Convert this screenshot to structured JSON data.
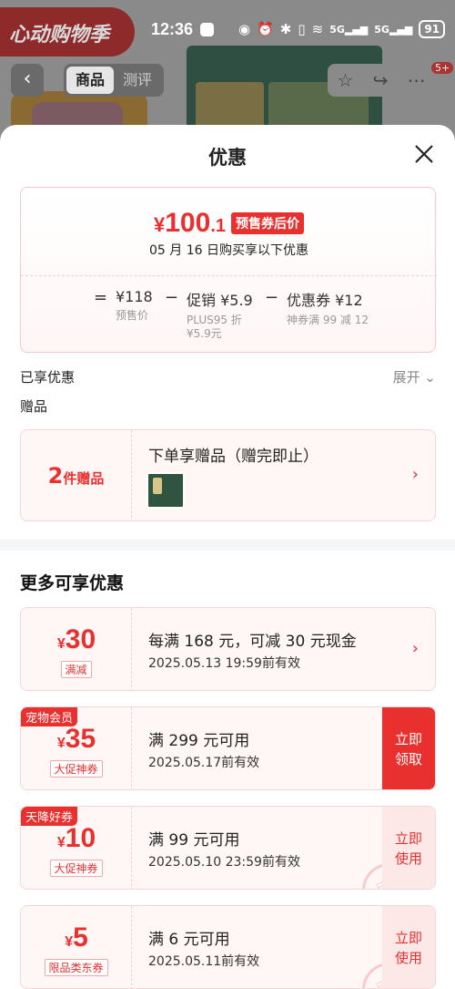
{
  "status_bar": {
    "time": "12:36",
    "battery": "91",
    "signal_1": "5G",
    "signal_2": "5G"
  },
  "background": {
    "banner_text": "心动购物季"
  },
  "nav": {
    "tabs": [
      "商品",
      "测评"
    ],
    "active_tab": "商品",
    "badge": "5+"
  },
  "sheet": {
    "title": "优惠",
    "price_card": {
      "currency": "¥",
      "price_int": "100",
      "price_dec": ".1",
      "tag": "预售券后价",
      "date_line": "05 月 16 日购买享以下优惠",
      "equals": "=",
      "terms": [
        {
          "main": "¥118",
          "sub": [
            "预售价"
          ]
        },
        {
          "main": "促销 ¥5.9",
          "sub": [
            "PLUS95 折",
            "¥5.9元"
          ]
        },
        {
          "main": "优惠券 ¥12",
          "sub": [
            "神券满 99 减 12"
          ]
        }
      ],
      "minus": "−"
    },
    "enjoyed_label": "已享优惠",
    "expand_label": "展开",
    "gift_label": "赠品",
    "gift_card": {
      "count": "2",
      "count_suffix": "件赠品",
      "title": "下单享赠品（赠完即止）"
    },
    "more_title": "更多可享优惠",
    "coupons": [
      {
        "corner": "",
        "symbol": "¥",
        "amount": "30",
        "tag": "满减",
        "desc": "每满 168 元，可减 30 元现金",
        "expiry": "2025.05.13 19:59前有效",
        "action": "",
        "action_style": "chevron"
      },
      {
        "corner": "宠物会员",
        "symbol": "¥",
        "amount": "35",
        "tag": "大促神券",
        "desc": "满 299 元可用",
        "expiry": "2025.05.17前有效",
        "action": "立即\n领取",
        "action_style": "fill"
      },
      {
        "corner": "天降好券",
        "symbol": "¥",
        "amount": "10",
        "tag": "大促神券",
        "desc": "满 99 元可用",
        "expiry": "2025.05.10 23:59前有效",
        "action": "立即\n使用",
        "action_style": "light",
        "stamp": "已领"
      },
      {
        "corner": "",
        "symbol": "¥",
        "amount": "5",
        "tag": "限品类东券",
        "desc": "满 6 元可用",
        "expiry": "2025.05.11前有效",
        "action": "立即\n使用",
        "action_style": "light",
        "stamp": "已领"
      }
    ]
  },
  "colors": {
    "accent": "#e8302f",
    "card_bg": "#fff6f6"
  }
}
